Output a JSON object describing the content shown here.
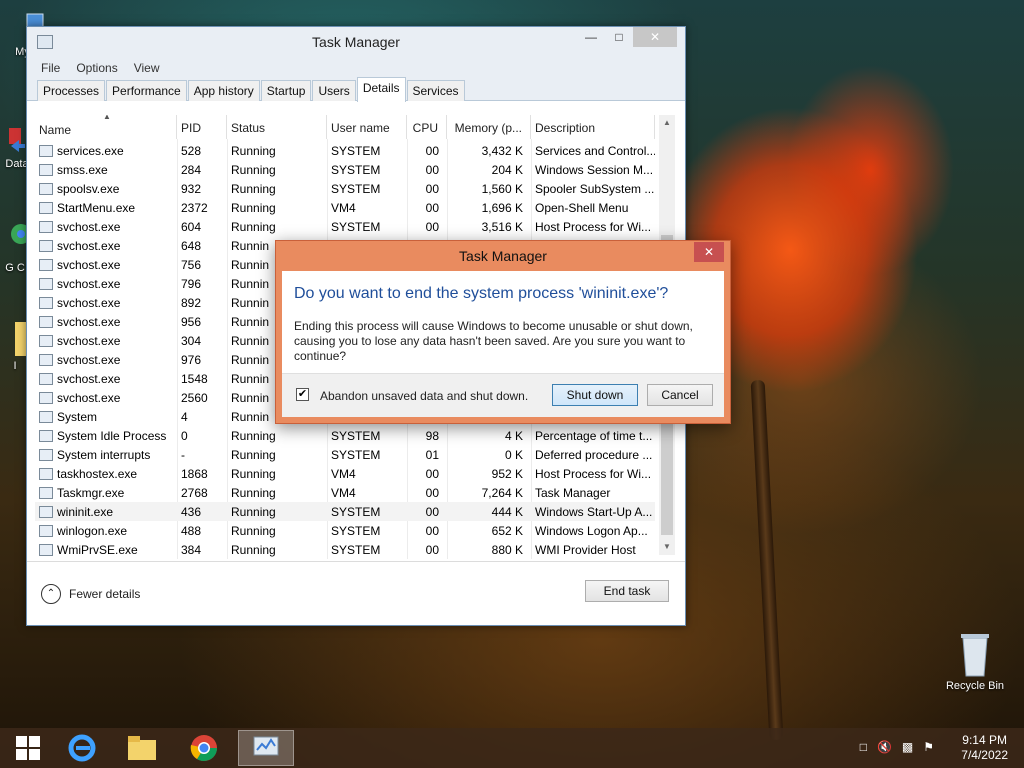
{
  "desktop": {
    "icons": [
      {
        "label": "My C"
      },
      {
        "label": "Data"
      },
      {
        "label": "G C"
      },
      {
        "label": "I"
      },
      {
        "label": "Recycle Bin"
      }
    ]
  },
  "task_manager": {
    "title": "Task Manager",
    "menu": [
      "File",
      "Options",
      "View"
    ],
    "tabs": [
      "Processes",
      "Performance",
      "App history",
      "Startup",
      "Users",
      "Details",
      "Services"
    ],
    "active_tab": "Details",
    "columns": [
      "Name",
      "PID",
      "Status",
      "User name",
      "CPU",
      "Memory (p...",
      "Description"
    ],
    "rows": [
      {
        "name": "services.exe",
        "pid": "528",
        "status": "Running",
        "user": "SYSTEM",
        "cpu": "00",
        "mem": "3,432 K",
        "desc": "Services and Control..."
      },
      {
        "name": "smss.exe",
        "pid": "284",
        "status": "Running",
        "user": "SYSTEM",
        "cpu": "00",
        "mem": "204 K",
        "desc": "Windows Session M..."
      },
      {
        "name": "spoolsv.exe",
        "pid": "932",
        "status": "Running",
        "user": "SYSTEM",
        "cpu": "00",
        "mem": "1,560 K",
        "desc": "Spooler SubSystem ..."
      },
      {
        "name": "StartMenu.exe",
        "pid": "2372",
        "status": "Running",
        "user": "VM4",
        "cpu": "00",
        "mem": "1,696 K",
        "desc": "Open-Shell Menu"
      },
      {
        "name": "svchost.exe",
        "pid": "604",
        "status": "Running",
        "user": "SYSTEM",
        "cpu": "00",
        "mem": "3,516 K",
        "desc": "Host Process for Wi..."
      },
      {
        "name": "svchost.exe",
        "pid": "648",
        "status": "Runnin",
        "user": "",
        "cpu": "",
        "mem": "",
        "desc": ""
      },
      {
        "name": "svchost.exe",
        "pid": "756",
        "status": "Runnin",
        "user": "",
        "cpu": "",
        "mem": "",
        "desc": ""
      },
      {
        "name": "svchost.exe",
        "pid": "796",
        "status": "Runnin",
        "user": "",
        "cpu": "",
        "mem": "",
        "desc": ""
      },
      {
        "name": "svchost.exe",
        "pid": "892",
        "status": "Runnin",
        "user": "",
        "cpu": "",
        "mem": "",
        "desc": ""
      },
      {
        "name": "svchost.exe",
        "pid": "956",
        "status": "Runnin",
        "user": "",
        "cpu": "",
        "mem": "",
        "desc": ""
      },
      {
        "name": "svchost.exe",
        "pid": "304",
        "status": "Runnin",
        "user": "",
        "cpu": "",
        "mem": "",
        "desc": ""
      },
      {
        "name": "svchost.exe",
        "pid": "976",
        "status": "Runnin",
        "user": "",
        "cpu": "",
        "mem": "",
        "desc": ""
      },
      {
        "name": "svchost.exe",
        "pid": "1548",
        "status": "Runnin",
        "user": "",
        "cpu": "",
        "mem": "",
        "desc": ""
      },
      {
        "name": "svchost.exe",
        "pid": "2560",
        "status": "Runnin",
        "user": "",
        "cpu": "",
        "mem": "",
        "desc": ""
      },
      {
        "name": "System",
        "pid": "4",
        "status": "Runnin",
        "user": "",
        "cpu": "",
        "mem": "",
        "desc": ""
      },
      {
        "name": "System Idle Process",
        "pid": "0",
        "status": "Running",
        "user": "SYSTEM",
        "cpu": "98",
        "mem": "4 K",
        "desc": "Percentage of time t..."
      },
      {
        "name": "System interrupts",
        "pid": "-",
        "status": "Running",
        "user": "SYSTEM",
        "cpu": "01",
        "mem": "0 K",
        "desc": "Deferred procedure ..."
      },
      {
        "name": "taskhostex.exe",
        "pid": "1868",
        "status": "Running",
        "user": "VM4",
        "cpu": "00",
        "mem": "952 K",
        "desc": "Host Process for Wi..."
      },
      {
        "name": "Taskmgr.exe",
        "pid": "2768",
        "status": "Running",
        "user": "VM4",
        "cpu": "00",
        "mem": "7,264 K",
        "desc": "Task Manager"
      },
      {
        "name": "wininit.exe",
        "pid": "436",
        "status": "Running",
        "user": "SYSTEM",
        "cpu": "00",
        "mem": "444 K",
        "desc": "Windows Start-Up A...",
        "selected": true
      },
      {
        "name": "winlogon.exe",
        "pid": "488",
        "status": "Running",
        "user": "SYSTEM",
        "cpu": "00",
        "mem": "652 K",
        "desc": "Windows Logon Ap..."
      },
      {
        "name": "WmiPrvSE.exe",
        "pid": "384",
        "status": "Running",
        "user": "SYSTEM",
        "cpu": "00",
        "mem": "880 K",
        "desc": "WMI Provider Host"
      }
    ],
    "fewer_details": "Fewer details",
    "end_task": "End task"
  },
  "dialog": {
    "title": "Task Manager",
    "heading": "Do you want to end the system process 'wininit.exe'?",
    "message": "Ending this process will cause Windows to become unusable or shut down, causing you to lose any data hasn't been saved. Are you sure you want to continue?",
    "checkbox_label": "Abandon unsaved data and shut down.",
    "checkbox_checked": true,
    "primary_button": "Shut down",
    "secondary_button": "Cancel"
  },
  "taskbar": {
    "time": "9:14 PM",
    "date": "7/4/2022"
  },
  "colors": {
    "dialog_frame": "#e98b5f",
    "heading_blue": "#1f4e9a",
    "window_border": "#6b8fb3"
  }
}
